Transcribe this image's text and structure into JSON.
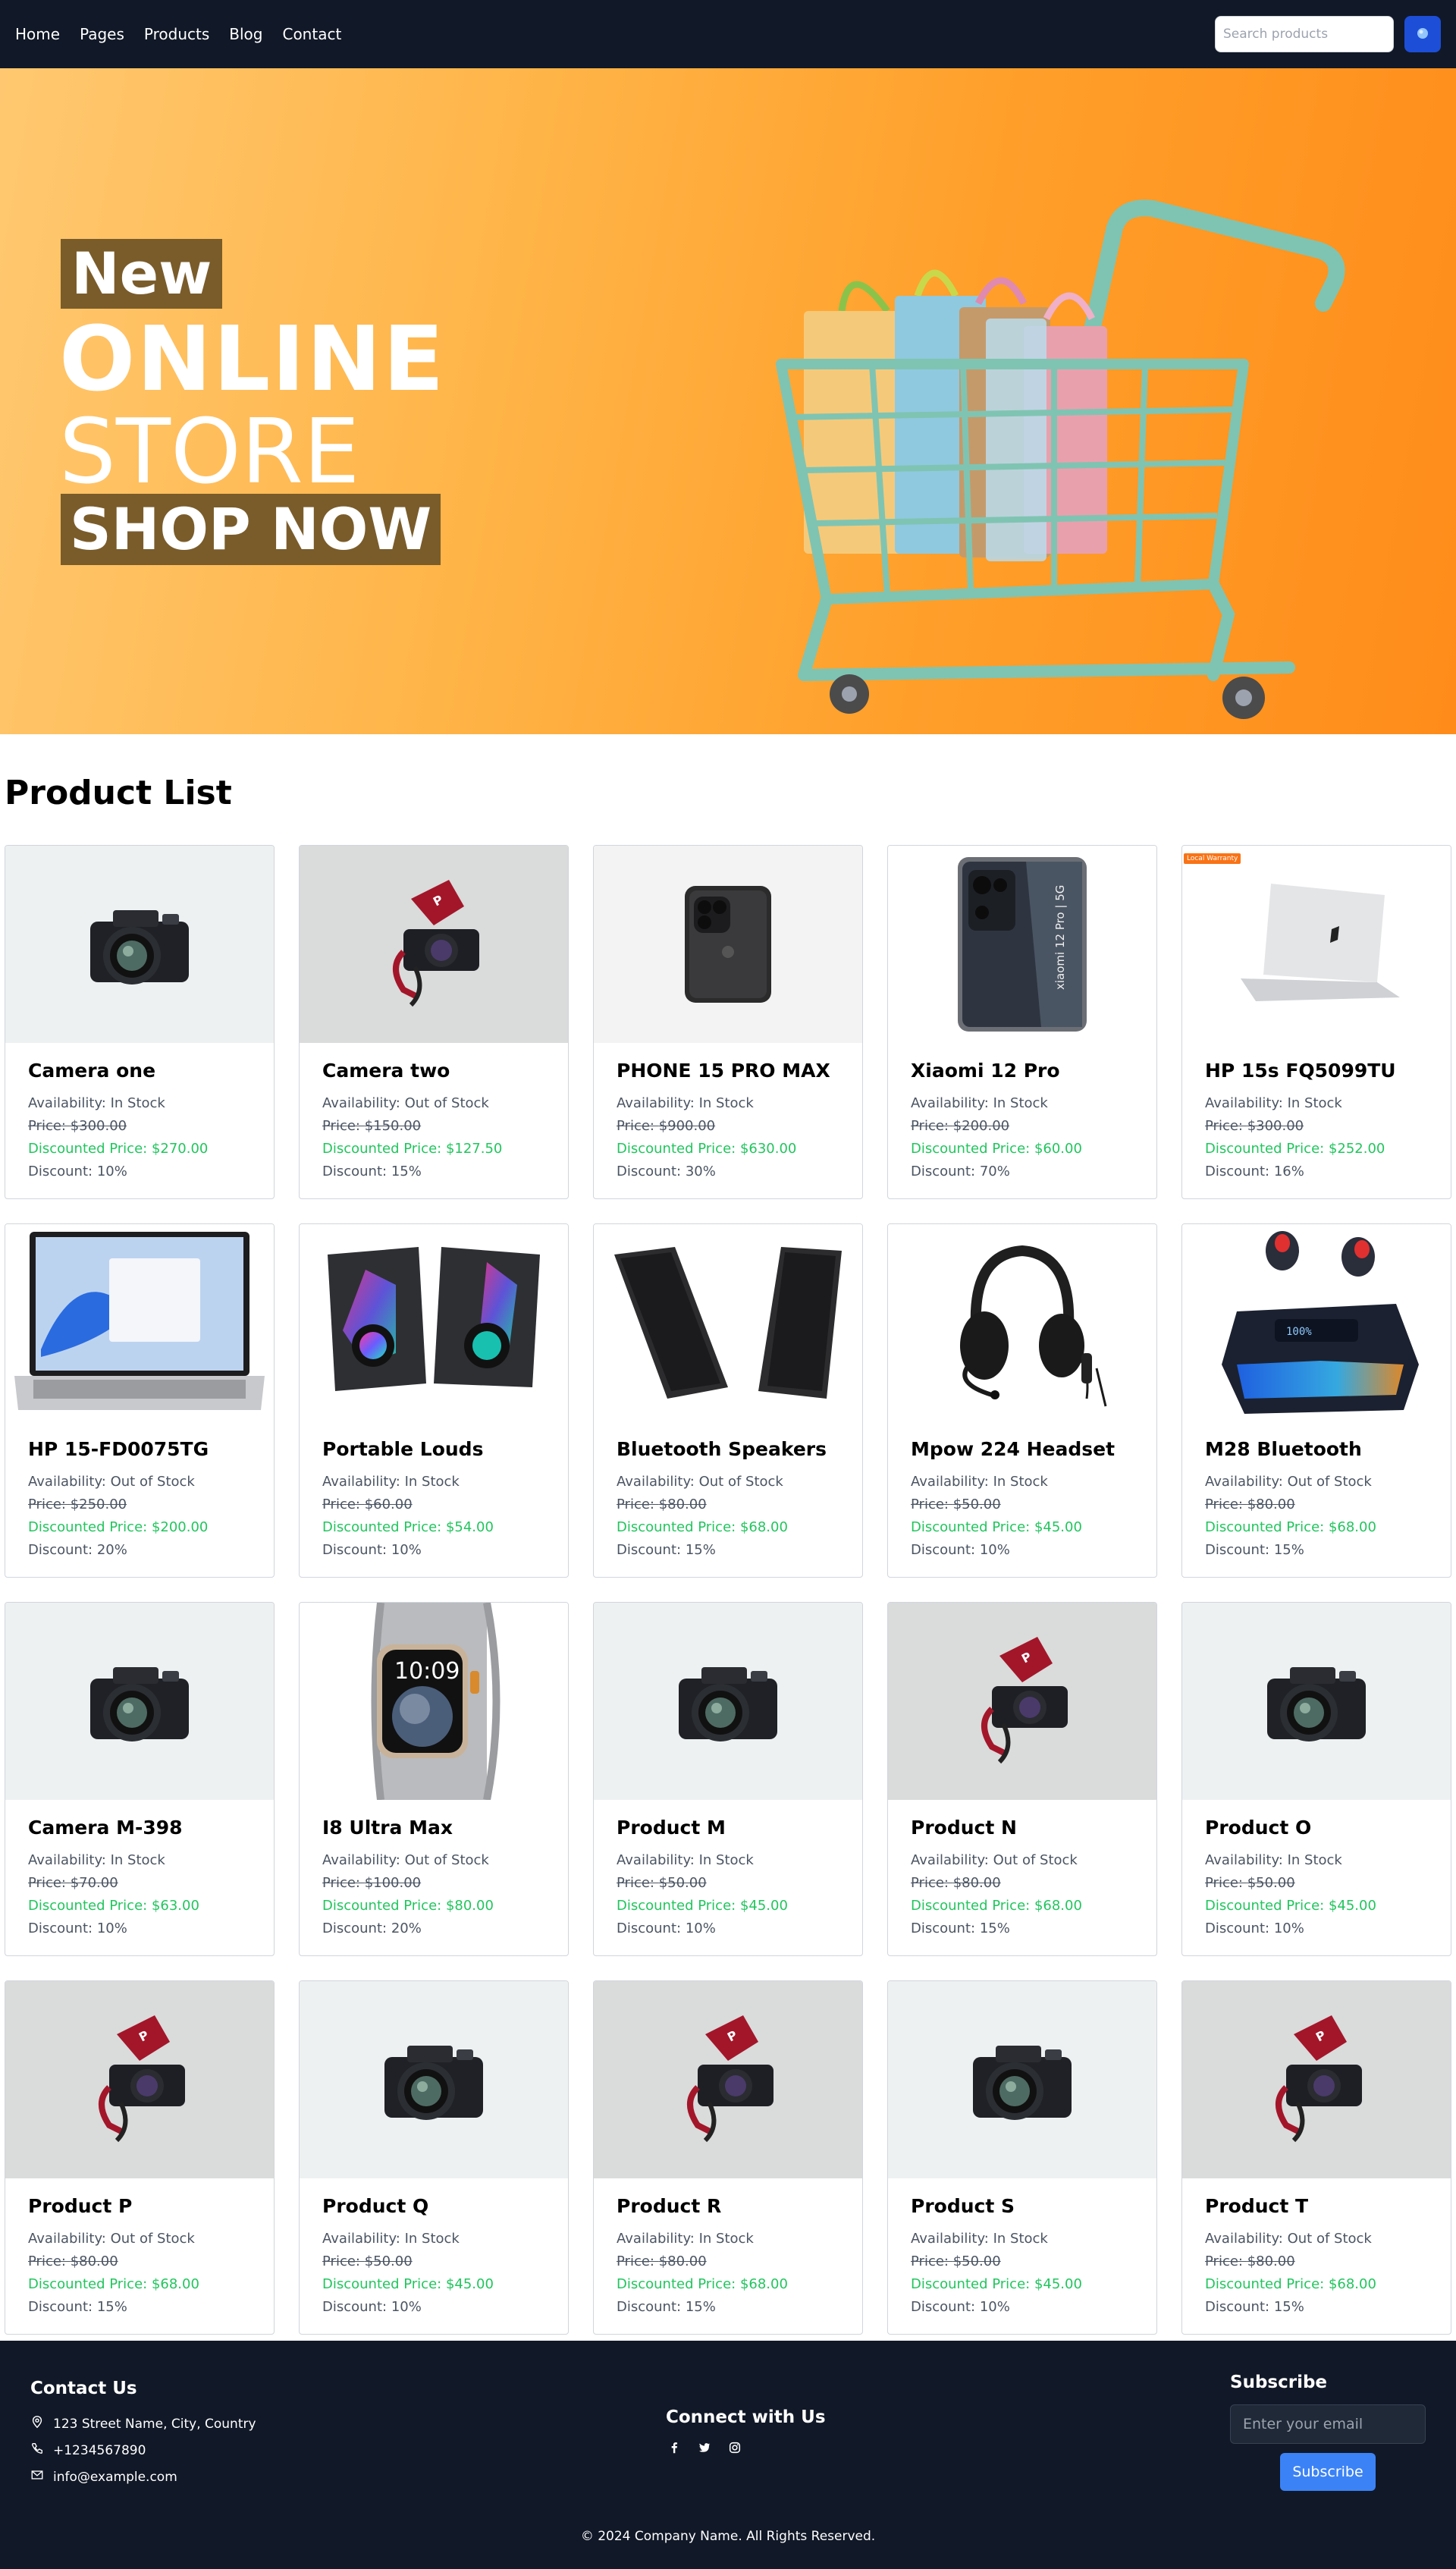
{
  "nav": {
    "links": [
      "Home",
      "Pages",
      "Products",
      "Blog",
      "Contact"
    ],
    "search_placeholder": "Search products"
  },
  "hero": {
    "tag": "New",
    "line1": "ONLINE",
    "line2": "STORE",
    "cta": "SHOP NOW"
  },
  "section_title": "Product List",
  "labels": {
    "availability": "Availability: ",
    "price": "Price: ",
    "discounted_price": "Discounted Price: ",
    "discount": "Discount: "
  },
  "products": [
    {
      "name": "Camera one",
      "availability": "In Stock",
      "price": "$300.00",
      "discounted": "$270.00",
      "discount": "10%",
      "image": "camera-black"
    },
    {
      "name": "Camera two",
      "availability": "Out of Stock",
      "price": "$150.00",
      "discounted": "$127.50",
      "discount": "15%",
      "image": "camera-strap"
    },
    {
      "name": "PHONE 15 PRO MAX",
      "availability": "In Stock",
      "price": "$900.00",
      "discounted": "$630.00",
      "discount": "30%",
      "image": "iphone"
    },
    {
      "name": "Xiaomi 12 Pro",
      "availability": "In Stock",
      "price": "$200.00",
      "discounted": "$60.00",
      "discount": "70%",
      "image": "android-phone"
    },
    {
      "name": "HP 15s FQ5099TU",
      "availability": "In Stock",
      "price": "$300.00",
      "discounted": "$252.00",
      "discount": "16%",
      "image": "laptop-silver",
      "badge": "Local Warranty"
    },
    {
      "name": "HP 15-FD0075TG",
      "availability": "Out of Stock",
      "price": "$250.00",
      "discounted": "$200.00",
      "discount": "20%",
      "image": "laptop-open"
    },
    {
      "name": "Portable Louds",
      "availability": "In Stock",
      "price": "$60.00",
      "discounted": "$54.00",
      "discount": "10%",
      "image": "rgb-speakers"
    },
    {
      "name": "Bluetooth Speakers",
      "availability": "Out of Stock",
      "price": "$80.00",
      "discounted": "$68.00",
      "discount": "15%",
      "image": "tall-speakers"
    },
    {
      "name": "Mpow 224 Headset",
      "availability": "In Stock",
      "price": "$50.00",
      "discounted": "$45.00",
      "discount": "10%",
      "image": "headset"
    },
    {
      "name": "M28 Bluetooth",
      "availability": "Out of Stock",
      "price": "$80.00",
      "discounted": "$68.00",
      "discount": "15%",
      "image": "earbuds"
    },
    {
      "name": "Camera M-398",
      "availability": "In Stock",
      "price": "$70.00",
      "discounted": "$63.00",
      "discount": "10%",
      "image": "camera-black"
    },
    {
      "name": "I8 Ultra Max",
      "availability": "Out of Stock",
      "price": "$100.00",
      "discounted": "$80.00",
      "discount": "20%",
      "image": "watch",
      "watch_time": "10:09"
    },
    {
      "name": "Product M",
      "availability": "In Stock",
      "price": "$50.00",
      "discounted": "$45.00",
      "discount": "10%",
      "image": "camera-black"
    },
    {
      "name": "Product N",
      "availability": "Out of Stock",
      "price": "$80.00",
      "discounted": "$68.00",
      "discount": "15%",
      "image": "camera-strap"
    },
    {
      "name": "Product O",
      "availability": "In Stock",
      "price": "$50.00",
      "discounted": "$45.00",
      "discount": "10%",
      "image": "camera-black"
    },
    {
      "name": "Product P",
      "availability": "Out of Stock",
      "price": "$80.00",
      "discounted": "$68.00",
      "discount": "15%",
      "image": "camera-strap"
    },
    {
      "name": "Product Q",
      "availability": "In Stock",
      "price": "$50.00",
      "discounted": "$45.00",
      "discount": "10%",
      "image": "camera-black"
    },
    {
      "name": "Product R",
      "availability": "In Stock",
      "price": "$80.00",
      "discounted": "$68.00",
      "discount": "15%",
      "image": "camera-strap"
    },
    {
      "name": "Product S",
      "availability": "In Stock",
      "price": "$50.00",
      "discounted": "$45.00",
      "discount": "10%",
      "image": "camera-black"
    },
    {
      "name": "Product T",
      "availability": "Out of Stock",
      "price": "$80.00",
      "discounted": "$68.00",
      "discount": "15%",
      "image": "camera-strap"
    }
  ],
  "footer": {
    "contact_title": "Contact Us",
    "address": "123 Street Name, City, Country",
    "phone": "+1234567890",
    "email": "info@example.com",
    "connect_title": "Connect with Us",
    "social_icons": [
      "facebook-icon",
      "twitter-icon",
      "instagram-icon"
    ],
    "subscribe_title": "Subscribe",
    "subscribe_placeholder": "Enter your email",
    "subscribe_button": "Subscribe",
    "copyright": "© 2024 Company Name. All Rights Reserved."
  },
  "colors": {
    "navbar": "#111827",
    "accent_blue": "#3b82f6",
    "discount_green": "#22c55e",
    "hero_orange": "#ffa533",
    "hero_label_bg": "#7a5c2b"
  }
}
